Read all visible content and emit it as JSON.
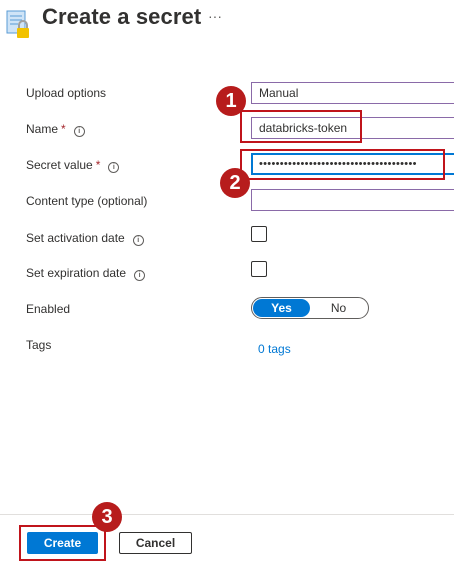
{
  "header": {
    "title": "Create a secret",
    "more": "···"
  },
  "form": {
    "upload_options": {
      "label": "Upload options",
      "value": "Manual"
    },
    "name": {
      "label": "Name",
      "required_mark": "*",
      "info": "i",
      "value": "databricks-token"
    },
    "secret_value": {
      "label": "Secret value",
      "required_mark": "*",
      "info": "i",
      "value": "••••••••••••••••••••••••••••••••••••••"
    },
    "content_type": {
      "label": "Content type (optional)",
      "value": ""
    },
    "activation": {
      "label": "Set activation date",
      "info": "i",
      "checked": false
    },
    "expiration": {
      "label": "Set expiration date",
      "info": "i",
      "checked": false
    },
    "enabled": {
      "label": "Enabled",
      "yes": "Yes",
      "no": "No",
      "selected": "Yes"
    },
    "tags": {
      "label": "Tags",
      "link": "0 tags"
    }
  },
  "footer": {
    "create": "Create",
    "cancel": "Cancel"
  },
  "callouts": [
    "1",
    "2",
    "3"
  ],
  "colors": {
    "accent": "#0078d4",
    "callout": "#b71c1c",
    "required": "#a4262c"
  }
}
